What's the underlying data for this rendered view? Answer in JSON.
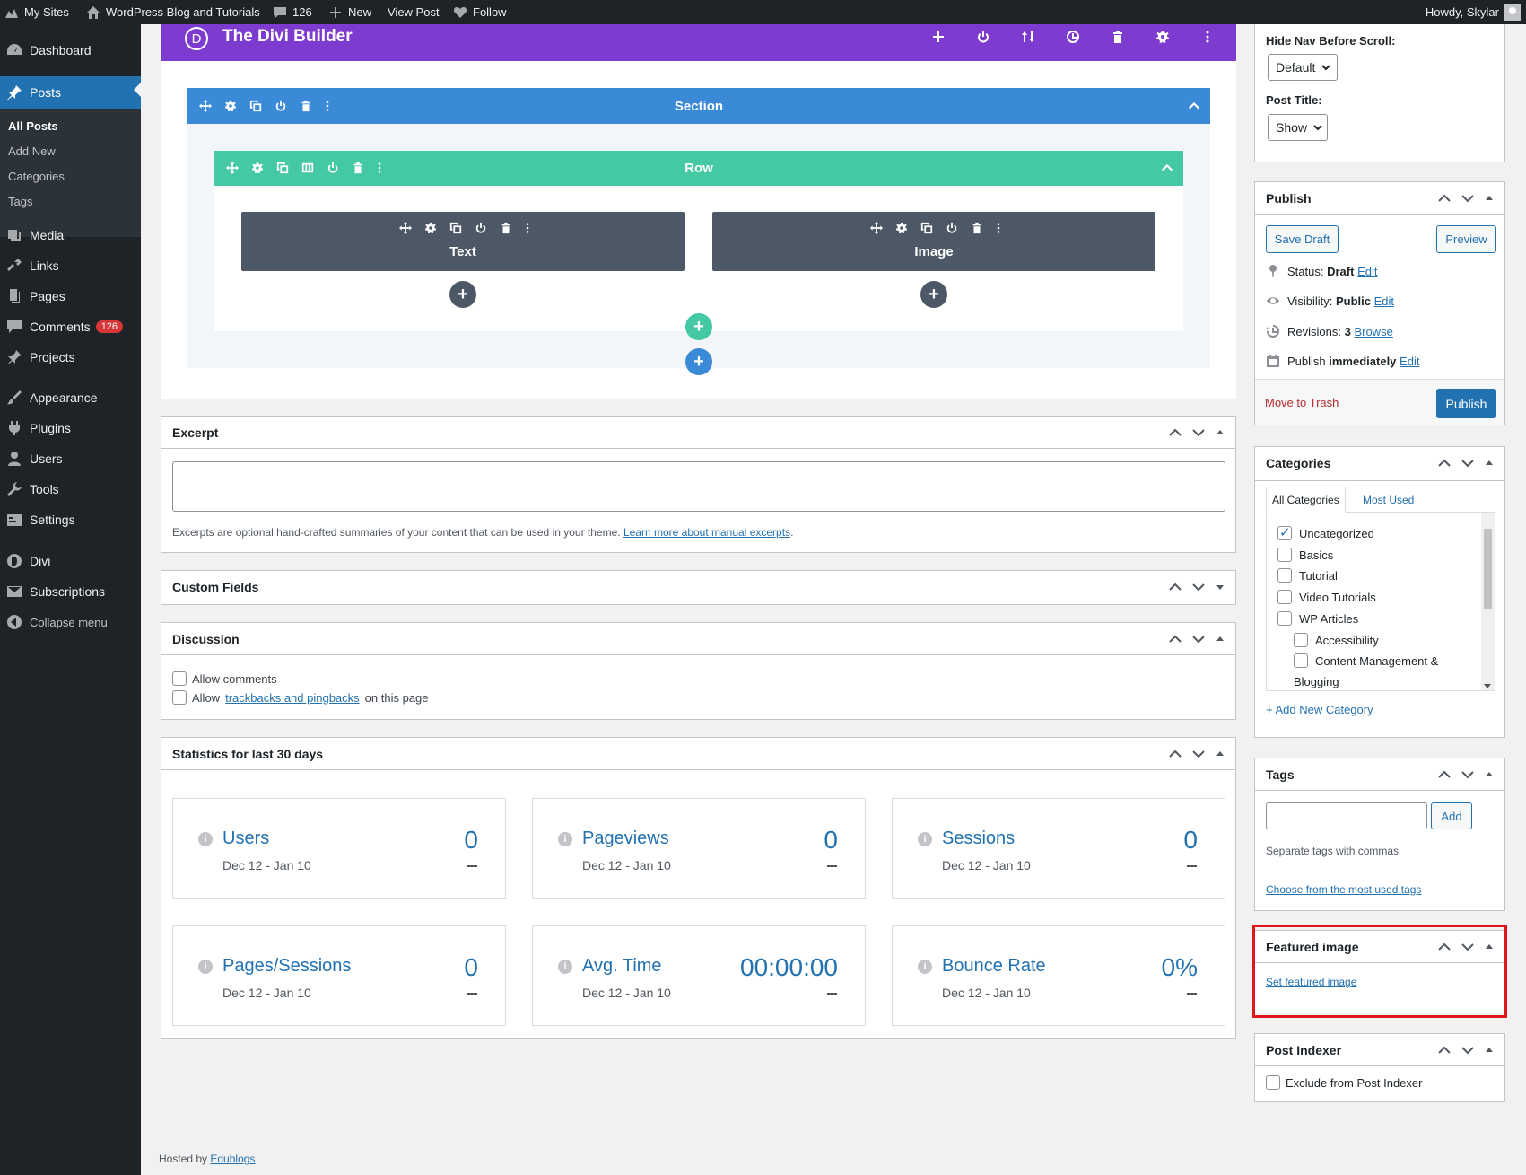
{
  "adminbar": {
    "my_sites": "My Sites",
    "site_name": "WordPress Blog and Tutorials",
    "comments_count": "126",
    "new": "New",
    "view_post": "View Post",
    "follow": "Follow",
    "howdy": "Howdy, Skylar"
  },
  "sidebar": {
    "dashboard": "Dashboard",
    "posts": "Posts",
    "sub": {
      "all_posts": "All Posts",
      "add_new": "Add New",
      "categories": "Categories",
      "tags": "Tags"
    },
    "media": "Media",
    "links": "Links",
    "pages": "Pages",
    "comments": "Comments",
    "comments_badge": "126",
    "projects": "Projects",
    "appearance": "Appearance",
    "plugins": "Plugins",
    "users": "Users",
    "tools": "Tools",
    "settings": "Settings",
    "divi": "Divi",
    "subscriptions": "Subscriptions",
    "collapse": "Collapse menu"
  },
  "divi": {
    "title": "The Divi Builder",
    "logo_letter": "D",
    "section_label": "Section",
    "row_label": "Row",
    "modules": [
      "Text",
      "Image"
    ],
    "colors": {
      "bar": "#7e3bd0",
      "section": "#3b8ad8",
      "row": "#45c9a4",
      "module": "#4c5866"
    }
  },
  "excerpt": {
    "title": "Excerpt",
    "help_text": "Excerpts are optional hand-crafted summaries of your content that can be used in your theme.",
    "help_link": "Learn more about manual excerpts",
    "help_end": "."
  },
  "custom_fields": {
    "title": "Custom Fields"
  },
  "discussion": {
    "title": "Discussion",
    "allow_comments": "Allow comments",
    "allow_prefix": "Allow",
    "trackbacks_link": "trackbacks and pingbacks",
    "allow_suffix": "on this page"
  },
  "stats": {
    "title": "Statistics for last 30 days",
    "cards": [
      {
        "label": "Users",
        "date": "Dec 12 - Jan 10",
        "value": "0"
      },
      {
        "label": "Pageviews",
        "date": "Dec 12 - Jan 10",
        "value": "0"
      },
      {
        "label": "Sessions",
        "date": "Dec 12 - Jan 10",
        "value": "0"
      },
      {
        "label": "Pages/Sessions",
        "date": "Dec 12 - Jan 10",
        "value": "0"
      },
      {
        "label": "Avg. Time",
        "date": "Dec 12 - Jan 10",
        "value": "00:00:00"
      },
      {
        "label": "Bounce Rate",
        "date": "Dec 12 - Jan 10",
        "value": "0%"
      }
    ]
  },
  "footer": {
    "hosted_by": "Hosted by",
    "link": "Edublogs"
  },
  "layout_box": {
    "hide_nav_label": "Hide Nav Before Scroll:",
    "hide_nav_value": "Default",
    "post_title_label": "Post Title:",
    "post_title_value": "Show"
  },
  "publish": {
    "title": "Publish",
    "save_draft": "Save Draft",
    "preview": "Preview",
    "status_label": "Status:",
    "status_value": "Draft",
    "visibility_label": "Visibility:",
    "visibility_value": "Public",
    "revisions_label": "Revisions:",
    "revisions_value": "3",
    "browse": "Browse",
    "publish_label": "Publish",
    "publish_when": "immediately",
    "edit": "Edit",
    "move_to_trash": "Move to Trash",
    "publish_button": "Publish"
  },
  "categories": {
    "title": "Categories",
    "tab_all": "All Categories",
    "tab_used": "Most Used",
    "items": [
      "Uncategorized",
      "Basics",
      "Tutorial",
      "Video Tutorials",
      "WP Articles",
      "Accessibility",
      "Content Management &",
      "Blogging"
    ],
    "add_new": "+ Add New Category"
  },
  "tags": {
    "title": "Tags",
    "add": "Add",
    "help": "Separate tags with commas",
    "choose": "Choose from the most used tags"
  },
  "featured_image": {
    "title": "Featured image",
    "set_link": "Set featured image",
    "highlight_color": "#e0161d"
  },
  "post_indexer": {
    "title": "Post Indexer",
    "exclude": "Exclude from Post Indexer"
  }
}
